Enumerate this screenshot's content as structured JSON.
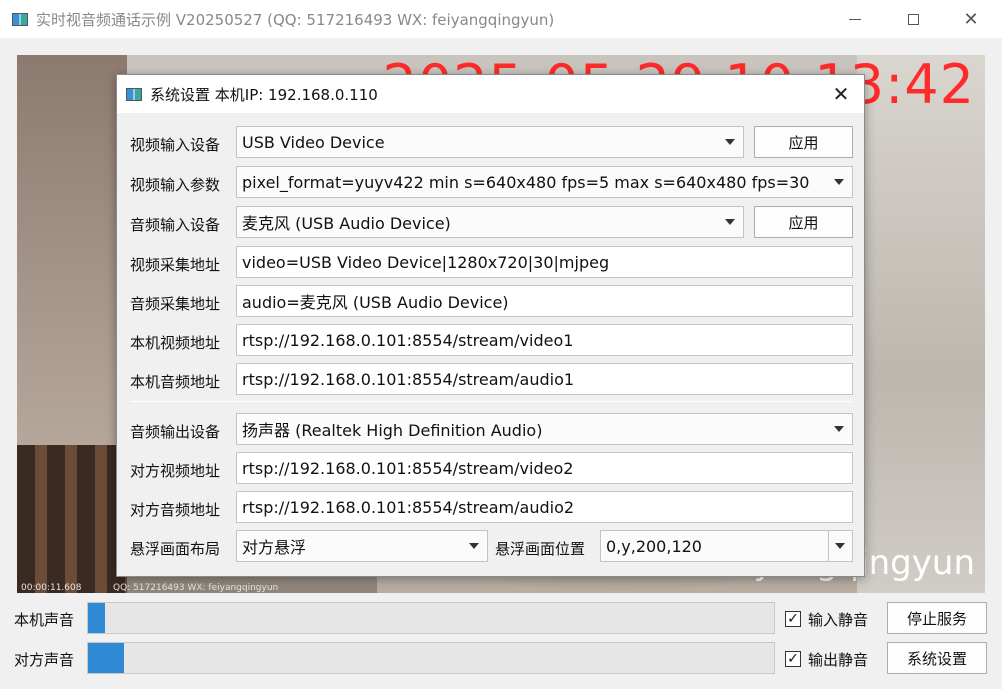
{
  "window": {
    "title": "实时视音频通话示例 V20250527 (QQ: 517216493 WX: feiyangqingyun)"
  },
  "video": {
    "clock": "2025-05-29 10:13:42",
    "watermark": "feiyangqingyun",
    "pip_time": "00:00:11.608",
    "pip_text": "QQ: 517216493  WX: feiyangqingyun"
  },
  "dialog": {
    "title": "系统设置  本机IP: 192.168.0.110",
    "video_input_device": {
      "label": "视频输入设备",
      "value": "USB Video Device",
      "apply": "应用"
    },
    "video_input_params": {
      "label": "视频输入参数",
      "value": "pixel_format=yuyv422 min s=640x480 fps=5 max s=640x480 fps=30"
    },
    "audio_input_device": {
      "label": "音频输入设备",
      "value": "麦克风 (USB Audio Device)",
      "apply": "应用"
    },
    "video_capture_url": {
      "label": "视频采集地址",
      "value": "video=USB Video Device|1280x720|30|mjpeg"
    },
    "audio_capture_url": {
      "label": "音频采集地址",
      "value": "audio=麦克风 (USB Audio Device)"
    },
    "local_video_url": {
      "label": "本机视频地址",
      "value": "rtsp://192.168.0.101:8554/stream/video1"
    },
    "local_audio_url": {
      "label": "本机音频地址",
      "value": "rtsp://192.168.0.101:8554/stream/audio1"
    },
    "audio_output_device": {
      "label": "音频输出设备",
      "value": "扬声器 (Realtek High Definition Audio)"
    },
    "remote_video_url": {
      "label": "对方视频地址",
      "value": "rtsp://192.168.0.101:8554/stream/video2"
    },
    "remote_audio_url": {
      "label": "对方音频地址",
      "value": "rtsp://192.168.0.101:8554/stream/audio2"
    },
    "float_layout": {
      "label": "悬浮画面布局",
      "value": "对方悬浮"
    },
    "float_position": {
      "label": "悬浮画面位置",
      "value": "0,y,200,120"
    }
  },
  "bottom": {
    "local_sound": {
      "label": "本机声音",
      "level": 0.025
    },
    "remote_sound": {
      "label": "对方声音",
      "level": 0.052
    },
    "input_mute": {
      "label": "输入静音",
      "checked": true
    },
    "output_mute": {
      "label": "输出静音",
      "checked": true
    },
    "stop_service": "停止服务",
    "system_settings": "系统设置"
  },
  "colors": {
    "meter_fill": "#2f8ad3",
    "clock": "#ff2a2a"
  }
}
